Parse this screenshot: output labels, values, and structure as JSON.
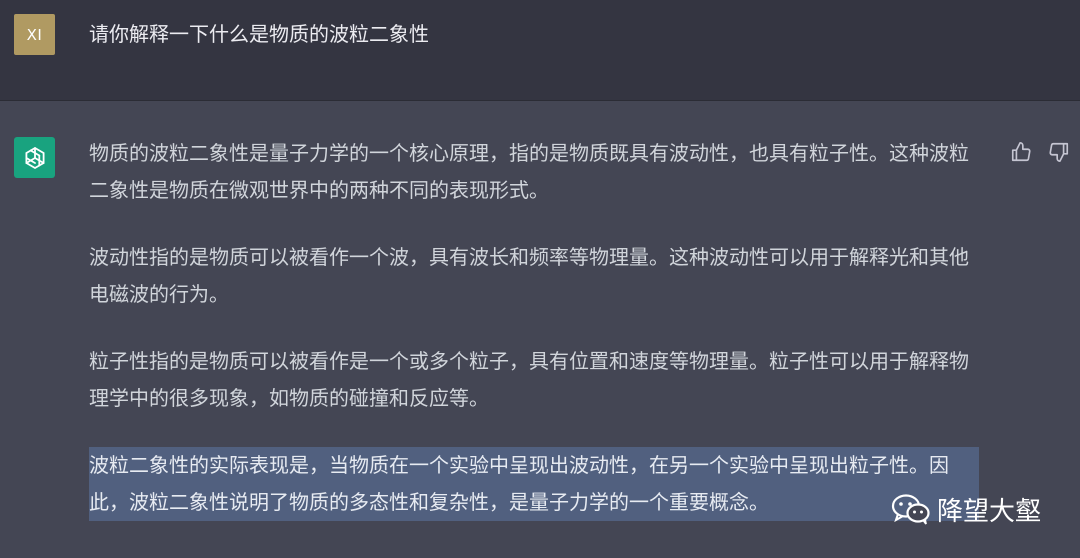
{
  "user_message": {
    "avatar_initials": "XI",
    "text": "请你解释一下什么是物质的波粒二象性"
  },
  "assistant_message": {
    "avatar_icon": "openai-logo-icon",
    "paragraphs": [
      "物质的波粒二象性是量子力学的一个核心原理，指的是物质既具有波动性，也具有粒子性。这种波粒二象性是物质在微观世界中的两种不同的表现形式。",
      "波动性指的是物质可以被看作一个波，具有波长和频率等物理量。这种波动性可以用于解释光和其他电磁波的行为。",
      "粒子性指的是物质可以被看作是一个或多个粒子，具有位置和速度等物理量。粒子性可以用于解释物理学中的很多现象，如物质的碰撞和反应等。",
      "波粒二象性的实际表现是，当物质在一个实验中呈现出波动性，在另一个实验中呈现出粒子性。因此，波粒二象性说明了物质的多态性和复杂性，是量子力学的一个重要概念。"
    ]
  },
  "feedback": {
    "thumbs_up_icon": "thumbs-up-icon",
    "thumbs_down_icon": "thumbs-down-icon"
  },
  "watermark": {
    "icon": "wechat-icon",
    "text": "降望大壑"
  },
  "colors": {
    "user_bg": "#343541",
    "assistant_bg": "#444654",
    "user_avatar": "#b09a62",
    "bot_avatar": "#19a37f",
    "selection": "#51607f"
  }
}
